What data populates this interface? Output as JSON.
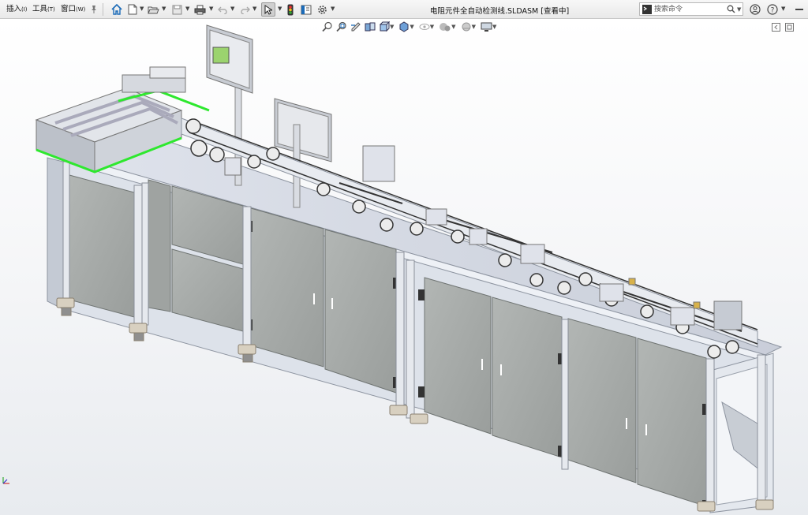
{
  "menu": {
    "items": [
      {
        "label": "插入",
        "accel": "(I)"
      },
      {
        "label": "工具",
        "accel": "(T)"
      },
      {
        "label": "窗口",
        "accel": "(W)"
      }
    ]
  },
  "window": {
    "title": "电阻元件全自动检测线.SLDASM [查看中]"
  },
  "search": {
    "placeholder": "搜索命令"
  },
  "icons": {
    "toolbar": [
      "pin-icon",
      "home-icon",
      "new-document-icon",
      "open-folder-icon",
      "save-icon",
      "print-icon",
      "undo-icon",
      "redo-icon",
      "select-arrow-icon",
      "traffic-light-icon",
      "file-properties-icon",
      "options-gear-icon"
    ],
    "right": [
      "command-prompt-icon",
      "magnifier-icon",
      "user-icon",
      "help-icon",
      "minimize-icon"
    ],
    "heads_up": [
      "zoom-to-fit-icon",
      "zoom-area-icon",
      "previous-view-icon",
      "section-view-icon",
      "view-orientation-icon",
      "display-style-icon",
      "hide-show-icon",
      "edit-appearance-icon",
      "scene-icon",
      "display-settings-icon"
    ]
  },
  "colors": {
    "frame": "#d8dde6",
    "panel": "#a9adab",
    "highlight_green": "#2ee82e",
    "belt": "#333333"
  }
}
